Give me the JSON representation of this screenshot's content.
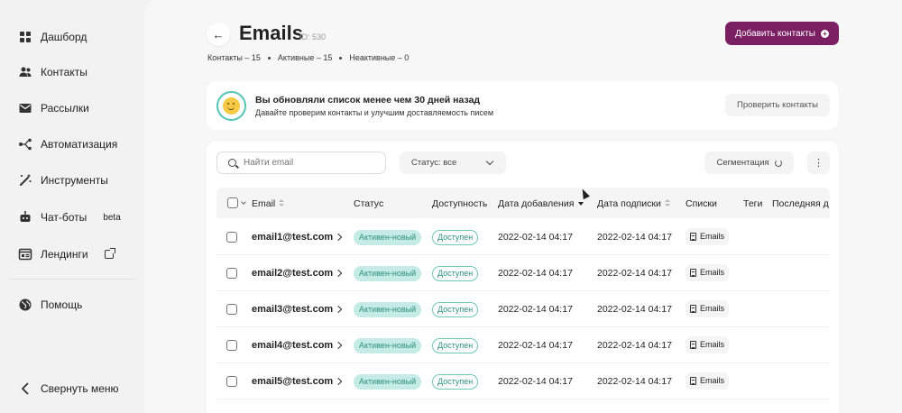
{
  "sidebar": {
    "items": [
      {
        "label": "Дашборд",
        "icon": "grid-icon"
      },
      {
        "label": "Контакты",
        "icon": "users-icon"
      },
      {
        "label": "Рассылки",
        "icon": "mail-icon"
      },
      {
        "label": "Автоматизация",
        "icon": "flow-icon"
      },
      {
        "label": "Инструменты",
        "icon": "wand-icon"
      },
      {
        "label": "Чат-боты",
        "icon": "bot-icon",
        "badge": "beta"
      },
      {
        "label": "Лендинги",
        "icon": "landing-icon"
      }
    ],
    "help": "Помощь",
    "collapse": "Свернуть меню"
  },
  "header": {
    "back_icon": "←",
    "title": "Emails",
    "id_label": "ID: 530",
    "stats": [
      "Контакты – 15",
      "Активные – 15",
      "Неактивные – 0"
    ],
    "add_button": "Добавить контакты",
    "add_icon": "+"
  },
  "banner": {
    "title": "Вы обновляли список менее чем 30 дней назад",
    "subtitle": "Давайте проверим контакты и улучшим доставляемость писем",
    "check_button": "Проверить контакты"
  },
  "toolbar": {
    "search_placeholder": "Найти email",
    "status_filter": "Статус: все",
    "segmentation": "Сегментация",
    "more": "⋮"
  },
  "table": {
    "columns": {
      "email": "Email",
      "status": "Статус",
      "availability": "Доступность",
      "added": "Дата добавления",
      "subscribed": "Дата подписки",
      "lists": "Списки",
      "tags": "Теги",
      "last": "Последняя д"
    },
    "rows": [
      {
        "email": "email1@test.com",
        "status": "Активен-новый",
        "availability": "Доступен",
        "added": "2022-02-14 04:17",
        "subscribed": "2022-02-14 04:17",
        "list": "Emails"
      },
      {
        "email": "email2@test.com",
        "status": "Активен-новый",
        "availability": "Доступен",
        "added": "2022-02-14 04:17",
        "subscribed": "2022-02-14 04:17",
        "list": "Emails"
      },
      {
        "email": "email3@test.com",
        "status": "Активен-новый",
        "availability": "Доступен",
        "added": "2022-02-14 04:17",
        "subscribed": "2022-02-14 04:17",
        "list": "Emails"
      },
      {
        "email": "email4@test.com",
        "status": "Активен-новый",
        "availability": "Доступен",
        "added": "2022-02-14 04:17",
        "subscribed": "2022-02-14 04:17",
        "list": "Emails"
      },
      {
        "email": "email5@test.com",
        "status": "Активен-новый",
        "availability": "Доступен",
        "added": "2022-02-14 04:17",
        "subscribed": "2022-02-14 04:17",
        "list": "Emails"
      }
    ]
  },
  "colors": {
    "accent": "#7b1f63",
    "status_pill_bg": "#c4ece4",
    "status_pill_text": "#2e8f7e"
  }
}
